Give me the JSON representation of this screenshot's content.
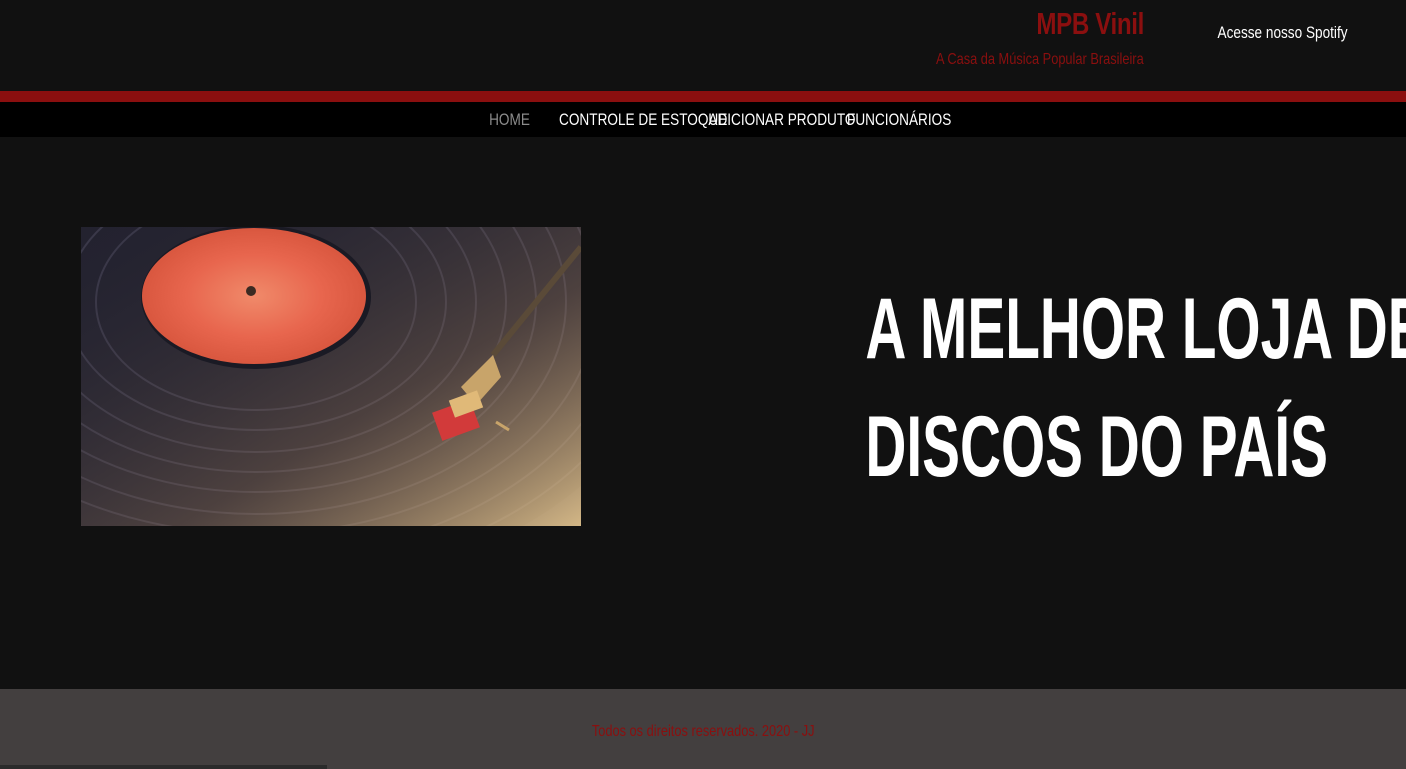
{
  "header": {
    "brand_title": "MPB Vinil",
    "brand_subtitle": "A Casa da Música Popular Brasileira",
    "spotify_link": "Acesse nosso Spotify"
  },
  "nav": {
    "items": [
      {
        "label": "HOME",
        "active": true
      },
      {
        "label": "CONTROLE DE ESTOQUE",
        "active": false
      },
      {
        "label": "ADICIONAR PRODUTO",
        "active": false
      },
      {
        "label": "FUNCIONÁRIOS",
        "active": false
      }
    ]
  },
  "hero": {
    "headline_line1": "A MELHOR LOJA DE",
    "headline_line2": "DISCOS DO PAÍS",
    "image": "vinyl-record-turntable"
  },
  "footer": {
    "text": "Todos os direitos reservados. 2020 - JJ"
  },
  "colors": {
    "accent": "#8b0f0f",
    "background": "#111111",
    "nav_bg": "#000000",
    "footer_bg": "#433f3f",
    "active_nav": "#8c8c8c"
  }
}
